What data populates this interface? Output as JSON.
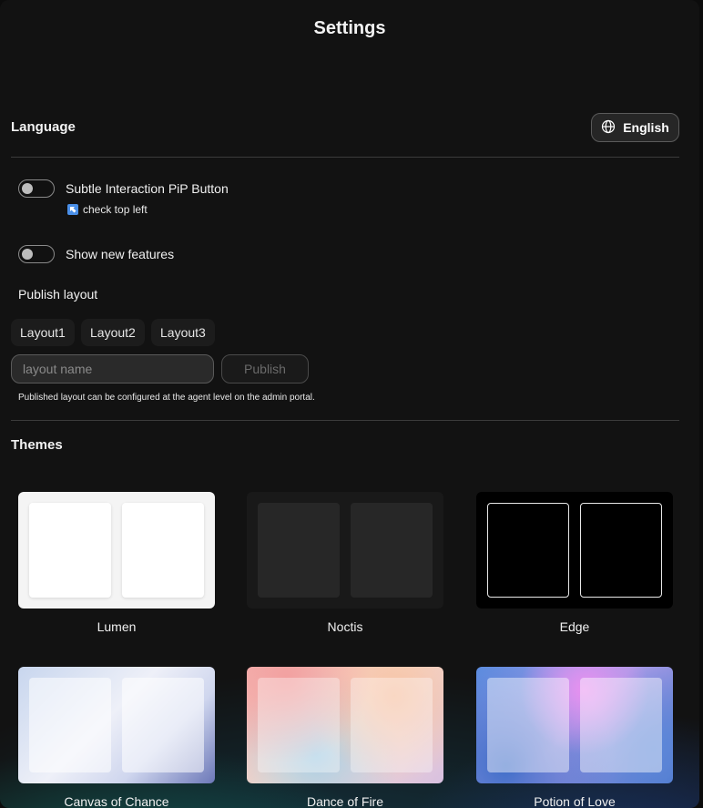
{
  "header": {
    "title": "Settings"
  },
  "language": {
    "title": "Language",
    "current": "English",
    "icon": "globe-icon"
  },
  "toggles": [
    {
      "label": "Subtle Interaction PiP Button",
      "on": false,
      "hint": "check top left",
      "hint_icon": "arrow-up-left-icon"
    },
    {
      "label": "Show new features",
      "on": false
    }
  ],
  "publish": {
    "title": "Publish layout",
    "layouts": [
      "Layout1",
      "Layout2",
      "Layout3"
    ],
    "input_placeholder": "layout name",
    "button_label": "Publish",
    "note": "Published layout can be configured at the agent level on the admin portal."
  },
  "themes": {
    "title": "Themes",
    "items": [
      {
        "name": "Lumen"
      },
      {
        "name": "Noctis"
      },
      {
        "name": "Edge"
      },
      {
        "name": "Canvas of Chance"
      },
      {
        "name": "Dance of Fire"
      },
      {
        "name": "Potion of Love"
      }
    ]
  },
  "colors": {
    "background": "#121212",
    "toggle_knob": "#bdbdbd",
    "hint_icon": "#4a8fe8"
  }
}
